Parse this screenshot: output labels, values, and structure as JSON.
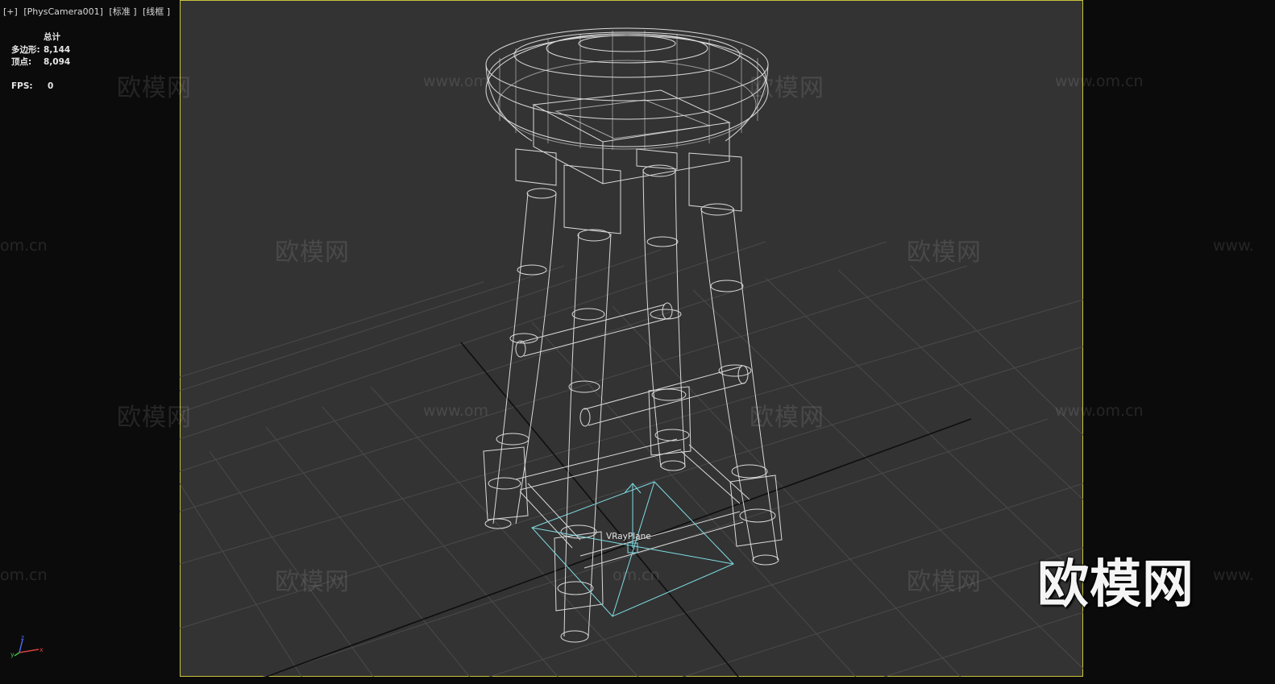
{
  "viewport": {
    "label_parts": [
      "[+]",
      "[PhysCamera001]",
      "[标准 ]",
      "[线框 ]"
    ]
  },
  "stats": {
    "header": "总计",
    "polygons_label": "多边形:",
    "polygons_value": "8,144",
    "vertices_label": "顶点:",
    "vertices_value": "8,094",
    "fps_label": "FPS:",
    "fps_value": "0"
  },
  "object_label": "VRayPlane",
  "brand_watermark": "欧模网",
  "watermark_cn": "欧模网",
  "watermark_url": "www.om.cn",
  "watermark_url_fragments": [
    "om.cn",
    "www.om",
    "www."
  ],
  "axis_gizmo": {
    "x": "x",
    "y": "y",
    "z": "z"
  },
  "colors": {
    "viewport_bg": "#333333",
    "outside_bg": "#0b0b0b",
    "safe_frame": "#c9c33a",
    "grid": "#4a4a4a",
    "wire": "#e8e8e8",
    "vray_plane": "#7fdde4"
  }
}
